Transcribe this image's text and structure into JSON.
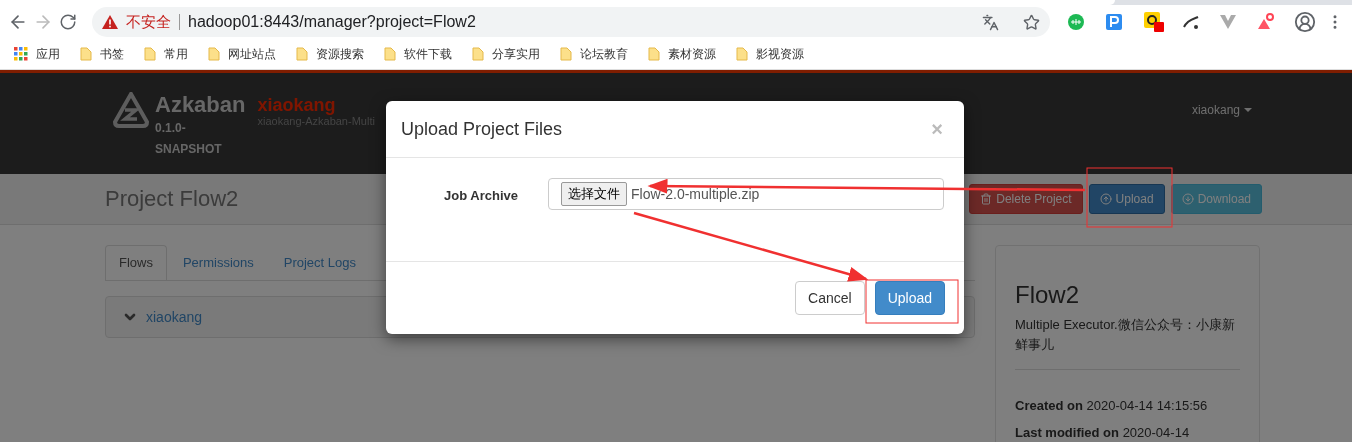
{
  "browser": {
    "security_label": "不安全",
    "url": "hadoop01:8443/manager?project=Flow2",
    "bookmarks": [
      {
        "label": "应用",
        "kind": "apps"
      },
      {
        "label": "书签",
        "kind": "folder"
      },
      {
        "label": "常用",
        "kind": "folder"
      },
      {
        "label": "网址站点",
        "kind": "folder"
      },
      {
        "label": "资源搜索",
        "kind": "folder"
      },
      {
        "label": "软件下载",
        "kind": "folder"
      },
      {
        "label": "分享实用",
        "kind": "folder"
      },
      {
        "label": "论坛教育",
        "kind": "folder"
      },
      {
        "label": "素材资源",
        "kind": "folder"
      },
      {
        "label": "影视资源",
        "kind": "folder"
      }
    ]
  },
  "header": {
    "brand": "Azkaban",
    "version": "0.1.0-SNAPSHOT",
    "project_name": "xiaokang",
    "project_description": "xiaokang-Azkaban-Multi",
    "user": "xiaokang"
  },
  "project": {
    "title": "Project Flow2",
    "actions": [
      {
        "label": "Delete Project",
        "kind": "danger"
      },
      {
        "label": "Upload",
        "kind": "primary"
      },
      {
        "label": "Download",
        "kind": "info"
      }
    ]
  },
  "tabs": [
    {
      "label": "Flows",
      "selected": true
    },
    {
      "label": "Permissions",
      "selected": false
    },
    {
      "label": "Project Logs",
      "selected": false
    }
  ],
  "flows": [
    {
      "name": "xiaokang"
    }
  ],
  "summary": {
    "name": "Flow2",
    "description": "Multiple Executor.微信公众号：小康新鲜事儿",
    "created_label": "Created on",
    "created": "2020-04-14 14:15:56",
    "modified_label": "Last modified on",
    "modified": "2020-04-14"
  },
  "modal": {
    "title": "Upload Project Files",
    "close": "×",
    "field_label": "Job Archive",
    "file_button": "选择文件",
    "file_name": "Flow-2.0-multiple.zip",
    "buttons": [
      {
        "label": "Cancel",
        "kind": "default"
      },
      {
        "label": "Upload",
        "kind": "primary"
      }
    ]
  }
}
